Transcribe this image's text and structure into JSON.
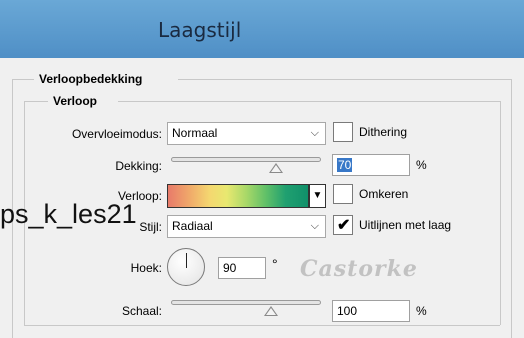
{
  "dialog": {
    "title": "Laagstijl"
  },
  "groups": {
    "outer_title": "Verloopbedekking",
    "inner_title": "Verloop"
  },
  "fields": {
    "blend_mode": {
      "label": "Overvloeimodus:",
      "value": "Normaal"
    },
    "dithering": {
      "label": "Dithering",
      "checked": false
    },
    "opacity": {
      "label": "Dekking:",
      "value": "70",
      "unit": "%",
      "level": 0.7
    },
    "gradient": {
      "label": "Verloop:"
    },
    "reverse": {
      "label": "Omkeren",
      "checked": false
    },
    "style": {
      "label": "Stijl:",
      "value": "Radiaal"
    },
    "align_layer": {
      "label": "Uitlijnen met laag",
      "checked": true,
      "check_glyph": "✔"
    },
    "angle": {
      "label": "Hoek:",
      "value": "90",
      "unit": "°"
    },
    "scale": {
      "label": "Schaal:",
      "value": "100",
      "unit": "%",
      "level": 1.0
    }
  },
  "overlay": {
    "text": "ps_k_les21",
    "watermark": "Castorke"
  },
  "icons": {
    "dropdown_chevron": "⌵",
    "gradient_dropdown": "▼"
  }
}
